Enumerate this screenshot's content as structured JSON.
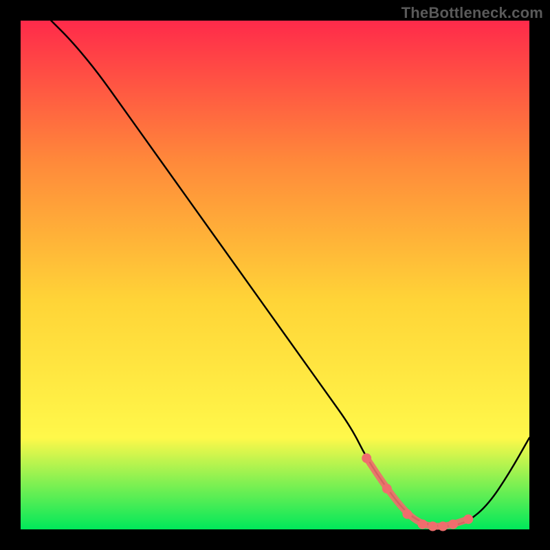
{
  "attribution": "TheBottleneck.com",
  "colors": {
    "gradient_top": "#ff2a4a",
    "gradient_mid_upper": "#ff8a3a",
    "gradient_mid": "#ffd437",
    "gradient_mid_lower": "#fff84a",
    "gradient_bottom": "#00e85a",
    "curve_stroke": "#000000",
    "valley_marker": "#ef6d6d",
    "text": "#5a5a5a",
    "background": "#000000"
  },
  "chart_data": {
    "type": "line",
    "title": "",
    "xlabel": "",
    "ylabel": "",
    "xlim": [
      0,
      100
    ],
    "ylim": [
      0,
      100
    ],
    "series": [
      {
        "name": "bottleneck-curve",
        "x": [
          6,
          10,
          15,
          20,
          25,
          30,
          35,
          40,
          45,
          50,
          55,
          60,
          65,
          68,
          72,
          76,
          80,
          84,
          88,
          92,
          96,
          100
        ],
        "y": [
          100,
          96,
          90,
          83,
          76,
          69,
          62,
          55,
          48,
          41,
          34,
          27,
          20,
          14,
          8,
          3,
          0.8,
          0.5,
          1.5,
          5,
          11,
          18
        ]
      },
      {
        "name": "valley-highlight",
        "x": [
          68,
          72,
          76,
          79,
          81,
          83,
          85,
          88
        ],
        "y": [
          14,
          8,
          3,
          1,
          0.6,
          0.6,
          1,
          2
        ]
      }
    ],
    "notes": "Values are estimated from pixel positions; x and y are percentage-of-plot-area coordinates (0 at left/bottom, 100 at right/top). Axes are unlabeled in the source image."
  }
}
